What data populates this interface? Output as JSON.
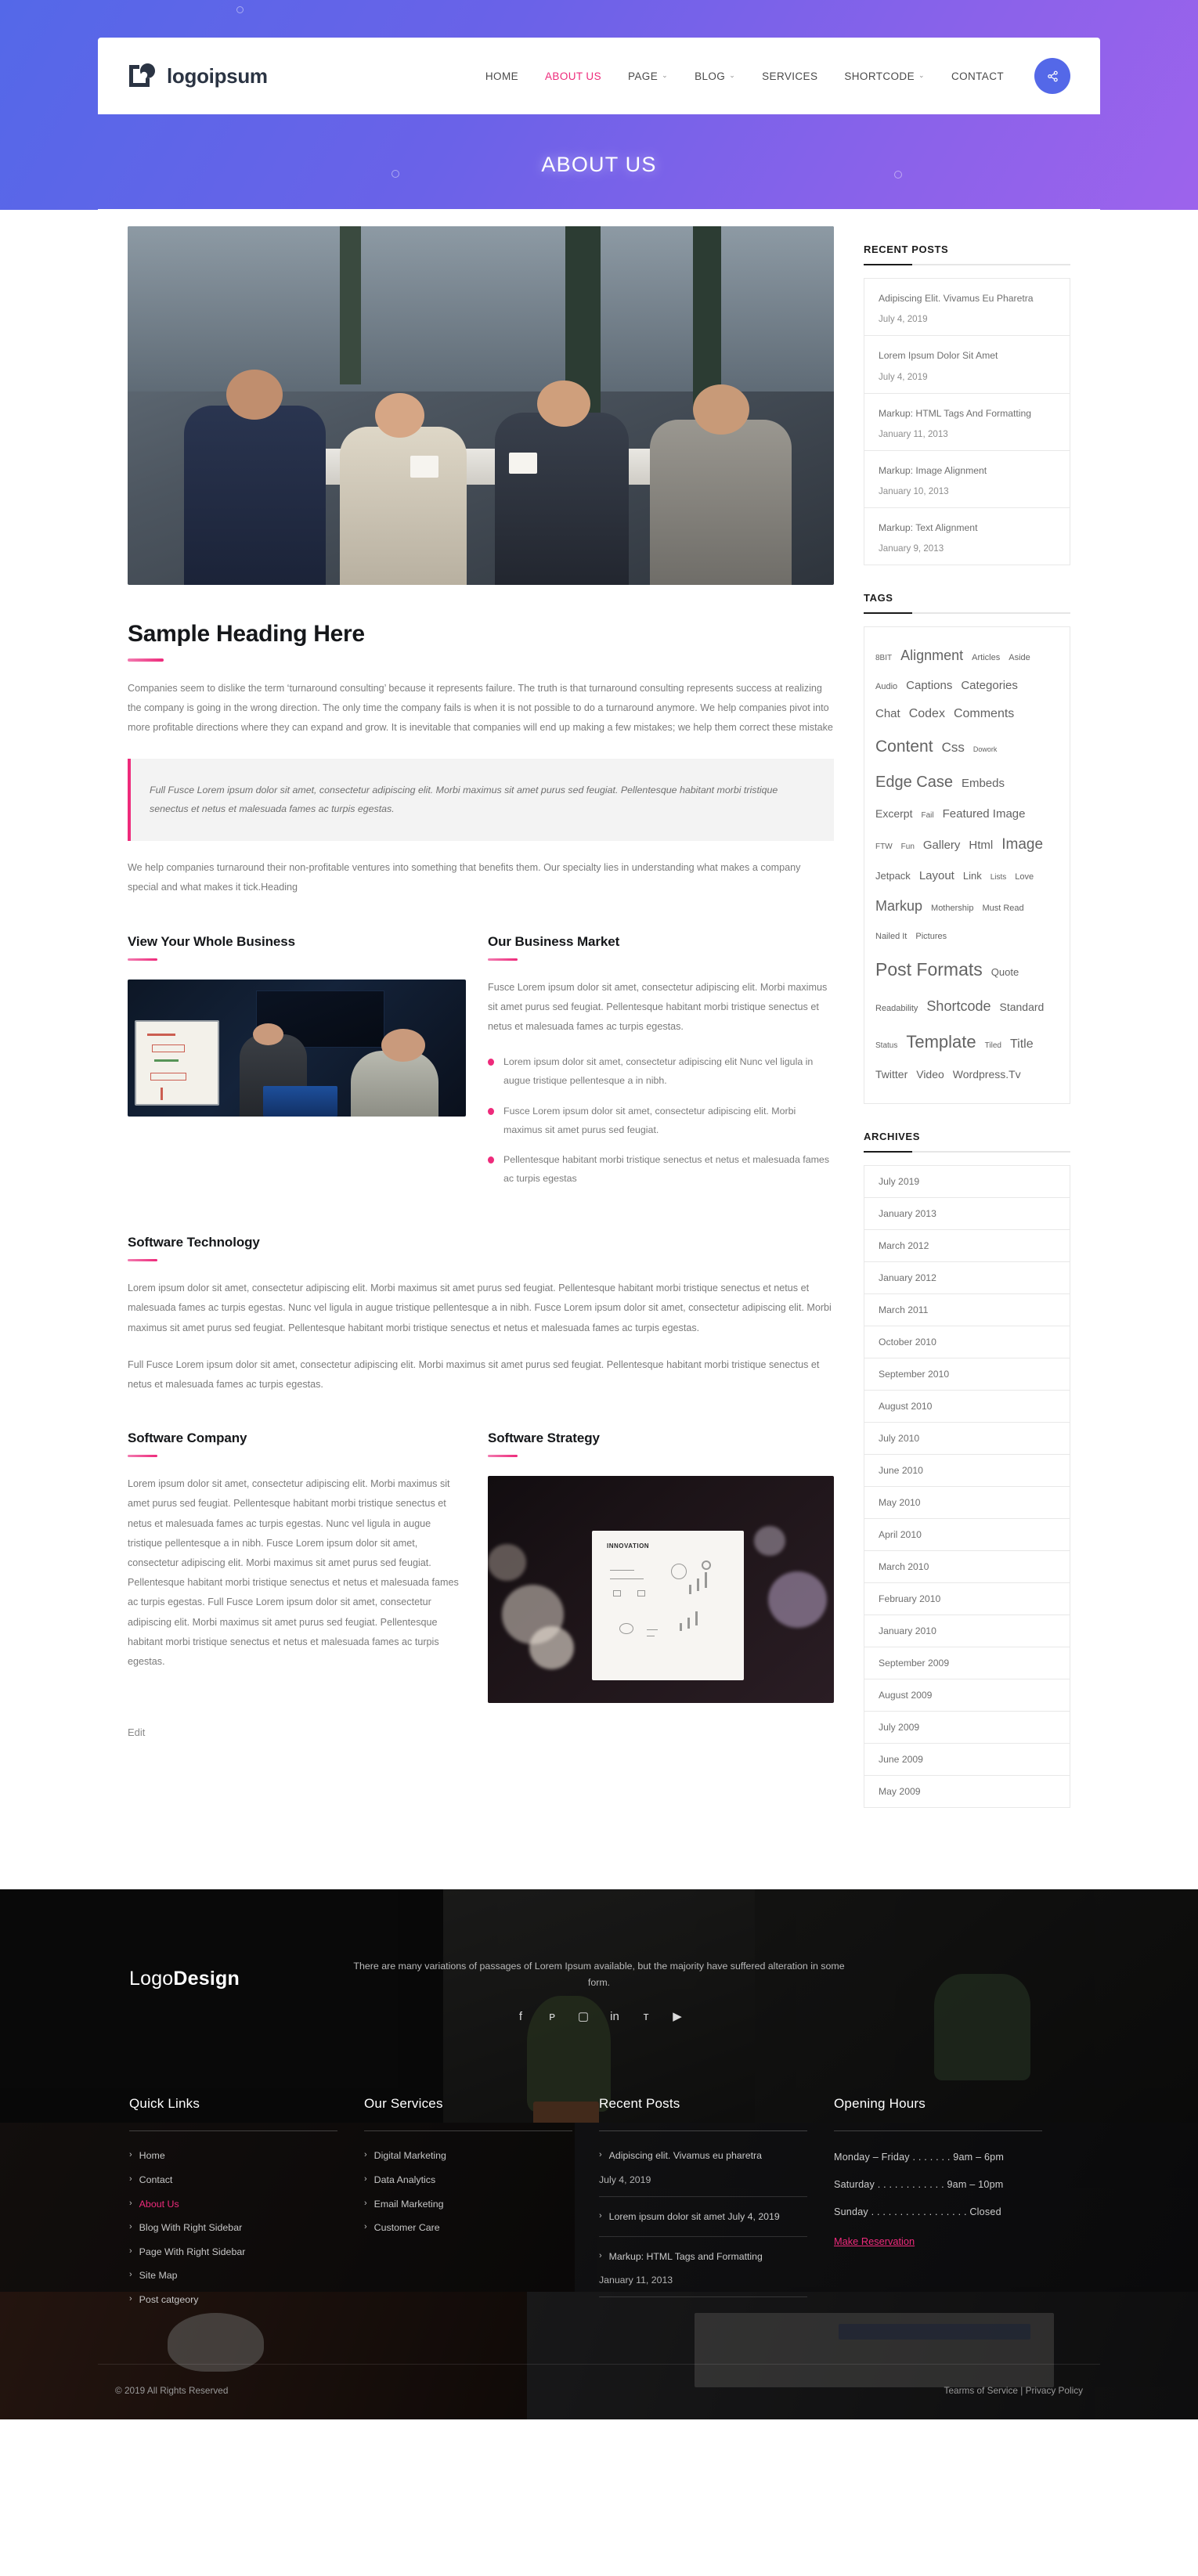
{
  "header": {
    "brand": "logoipsum",
    "brand_icon": "logo-mark-icon",
    "nav": [
      {
        "label": "HOME",
        "active": false,
        "caret": false
      },
      {
        "label": "ABOUT US",
        "active": true,
        "caret": false
      },
      {
        "label": "PAGE",
        "active": false,
        "caret": true
      },
      {
        "label": "BLOG",
        "active": false,
        "caret": true
      },
      {
        "label": "SERVICES",
        "active": false,
        "caret": false
      },
      {
        "label": "SHORTCODE",
        "active": false,
        "caret": true
      },
      {
        "label": "CONTACT",
        "active": false,
        "caret": false
      }
    ],
    "share_icon": "share-icon",
    "page_title": "ABOUT US"
  },
  "main": {
    "heading": "Sample Heading Here",
    "intro": "Companies seem to dislike the term ‘turnaround consulting’ because it represents failure. The truth is that turnaround consulting represents success at realizing the company is going in the wrong direction. The only time the company fails is when it is not possible to do a turnaround anymore. We help companies pivot into more profitable directions where they can expand and grow. It is inevitable that companies will end up making a few mistakes; we help them correct these mistake",
    "quote": "Full Fusce Lorem ipsum dolor sit amet, consectetur adipiscing elit. Morbi maximus sit amet purus sed feugiat. Pellentesque habitant morbi tristique senectus et netus et malesuada fames ac turpis egestas.",
    "after_quote": "We help companies turnaround their non-profitable ventures into something that benefits them. Our specialty lies in understanding what makes a company special and what makes it tick.Heading",
    "block_business": {
      "left_title": "View Your Whole Business",
      "left_image": "office-presentation-photo",
      "right_title": "Our Business Market",
      "right_paragraph": "Fusce Lorem ipsum dolor sit amet, consectetur adipiscing elit. Morbi maximus sit amet purus sed feugiat. Pellentesque habitant morbi tristique senectus et netus et malesuada fames ac turpis egestas.",
      "bullets": [
        "Lorem ipsum dolor sit amet, consectetur adipiscing elit Nunc vel ligula in augue tristique pellentesque a in nibh.",
        "Fusce Lorem ipsum dolor sit amet, consectetur adipiscing elit. Morbi maximus sit amet purus sed feugiat.",
        "Pellentesque habitant morbi tristique senectus et netus et malesuada fames ac turpis egestas"
      ]
    },
    "block_tech": {
      "title": "Software Technology",
      "paragraph1": "Lorem ipsum dolor sit amet, consectetur adipiscing elit. Morbi maximus sit amet purus sed feugiat. Pellentesque habitant morbi tristique senectus et netus et malesuada fames ac turpis egestas. Nunc vel ligula in augue tristique pellentesque a in nibh. Fusce Lorem ipsum dolor sit amet, consectetur adipiscing elit. Morbi maximus sit amet purus sed feugiat. Pellentesque habitant morbi tristique senectus et netus et malesuada fames ac turpis egestas.",
      "paragraph2": "Full Fusce Lorem ipsum dolor sit amet, consectetur adipiscing elit. Morbi maximus sit amet purus sed feugiat. Pellentesque habitant morbi tristique senectus et netus et malesuada fames ac turpis egestas."
    },
    "block_company": {
      "left_title": "Software Company",
      "left_paragraph": "Lorem ipsum dolor sit amet, consectetur adipiscing elit. Morbi maximus sit amet purus sed feugiat. Pellentesque habitant morbi tristique senectus et netus et malesuada fames ac turpis egestas. Nunc vel ligula in augue tristique pellentesque a in nibh. Fusce Lorem ipsum dolor sit amet, consectetur adipiscing elit. Morbi maximus sit amet purus sed feugiat. Pellentesque habitant morbi tristique senectus et netus et malesuada fames ac turpis egestas. Full Fusce Lorem ipsum dolor sit amet, consectetur adipiscing elit. Morbi maximus sit amet purus sed feugiat. Pellentesque habitant morbi tristique senectus et netus et malesuada fames ac turpis egestas.",
      "right_title": "Software Strategy",
      "right_image": "innovation-poster-photo",
      "poster_text": "INNOVATION"
    },
    "edit_link": "Edit"
  },
  "sidebar": {
    "recent_posts_title": "RECENT POSTS",
    "recent_posts": [
      {
        "title": "Adipiscing Elit. Vivamus Eu Pharetra",
        "date": "July 4, 2019"
      },
      {
        "title": "Lorem Ipsum Dolor Sit Amet",
        "date": "July 4, 2019"
      },
      {
        "title": "Markup: HTML Tags And Formatting",
        "date": "January 11, 2013"
      },
      {
        "title": "Markup: Image Alignment",
        "date": "January 10, 2013"
      },
      {
        "title": "Markup: Text Alignment",
        "date": "January 9, 2013"
      }
    ],
    "tags_title": "TAGS",
    "tags": [
      {
        "label": "8BIT",
        "size": 10
      },
      {
        "label": "Alignment",
        "size": 18
      },
      {
        "label": "Articles",
        "size": 11
      },
      {
        "label": "Aside",
        "size": 11
      },
      {
        "label": "Audio",
        "size": 11
      },
      {
        "label": "Captions",
        "size": 15
      },
      {
        "label": "Categories",
        "size": 15
      },
      {
        "label": "Chat",
        "size": 15
      },
      {
        "label": "Codex",
        "size": 16
      },
      {
        "label": "Comments",
        "size": 16
      },
      {
        "label": "Content",
        "size": 21
      },
      {
        "label": "Css",
        "size": 17
      },
      {
        "label": "Dowork",
        "size": 9
      },
      {
        "label": "Edge Case",
        "size": 20
      },
      {
        "label": "Embeds",
        "size": 15
      },
      {
        "label": "Excerpt",
        "size": 14
      },
      {
        "label": "Fail",
        "size": 10
      },
      {
        "label": "Featured Image",
        "size": 15
      },
      {
        "label": "FTW",
        "size": 10
      },
      {
        "label": "Fun",
        "size": 10
      },
      {
        "label": "Gallery",
        "size": 15
      },
      {
        "label": "Html",
        "size": 15
      },
      {
        "label": "Image",
        "size": 19
      },
      {
        "label": "Jetpack",
        "size": 13
      },
      {
        "label": "Layout",
        "size": 15
      },
      {
        "label": "Link",
        "size": 13
      },
      {
        "label": "Lists",
        "size": 10
      },
      {
        "label": "Love",
        "size": 11
      },
      {
        "label": "Markup",
        "size": 18
      },
      {
        "label": "Mothership",
        "size": 11
      },
      {
        "label": "Must Read",
        "size": 11
      },
      {
        "label": "Nailed It",
        "size": 11
      },
      {
        "label": "Pictures",
        "size": 11
      },
      {
        "label": "Post Formats",
        "size": 23
      },
      {
        "label": "Quote",
        "size": 13
      },
      {
        "label": "Readability",
        "size": 11
      },
      {
        "label": "Shortcode",
        "size": 18
      },
      {
        "label": "Standard",
        "size": 14
      },
      {
        "label": "Status",
        "size": 10
      },
      {
        "label": "Template",
        "size": 22
      },
      {
        "label": "Tiled",
        "size": 10
      },
      {
        "label": "Title",
        "size": 16
      },
      {
        "label": "Twitter",
        "size": 14
      },
      {
        "label": "Video",
        "size": 14
      },
      {
        "label": "Wordpress.Tv",
        "size": 14
      }
    ],
    "archives_title": "ARCHIVES",
    "archives": [
      "July 2019",
      "January 2013",
      "March 2012",
      "January 2012",
      "March 2011",
      "October 2010",
      "September 2010",
      "August 2010",
      "July 2010",
      "June 2010",
      "May 2010",
      "April 2010",
      "March 2010",
      "February 2010",
      "January 2010",
      "September 2009",
      "August 2009",
      "July 2009",
      "June 2009",
      "May 2009"
    ]
  },
  "footer": {
    "logo_light": "Logo",
    "logo_bold": "Design",
    "intro": "There are many variations of passages of Lorem Ipsum available, but the majority have suffered alteration in some form.",
    "socials": [
      {
        "name": "facebook-icon",
        "glyph": "f"
      },
      {
        "name": "pinterest-icon",
        "glyph": "ᴘ"
      },
      {
        "name": "instagram-icon",
        "glyph": "▢"
      },
      {
        "name": "linkedin-icon",
        "glyph": "in"
      },
      {
        "name": "twitter-icon",
        "glyph": "ᴛ"
      },
      {
        "name": "youtube-icon",
        "glyph": "▶"
      }
    ],
    "quick_links_title": "Quick Links",
    "quick_links": [
      {
        "label": "Home",
        "active": false
      },
      {
        "label": "Contact",
        "active": false
      },
      {
        "label": "About Us",
        "active": true
      },
      {
        "label": "Blog With Right Sidebar",
        "active": false
      },
      {
        "label": "Page With Right Sidebar",
        "active": false
      },
      {
        "label": "Site Map",
        "active": false
      },
      {
        "label": "Post catgeory",
        "active": false
      }
    ],
    "services_title": "Our Services",
    "services": [
      {
        "label": "Digital Marketing"
      },
      {
        "label": "Data Analytics"
      },
      {
        "label": "Email Marketing"
      },
      {
        "label": "Customer Care"
      }
    ],
    "recent_posts_title": "Recent Posts",
    "recent_posts": [
      {
        "title": "Adipiscing elit. Vivamus eu pharetra",
        "date": "July 4, 2019"
      },
      {
        "title": "Lorem ipsum dolor sit amet July 4, 2019",
        "date": ""
      },
      {
        "title": "Markup: HTML Tags and Formatting",
        "date": "January 11, 2013"
      }
    ],
    "hours_title": "Opening Hours",
    "hours": [
      "Monday – Friday . . . . . . . 9am – 6pm",
      "Saturday . . . . . . . . . . . . 9am – 10pm",
      "Sunday . . . . . . . . . . . . . . . . . Closed"
    ],
    "reserve_label": "Make Reservation",
    "copyright": "© 2019 All Rights Reserved",
    "legal_terms": "Tearms of Service",
    "legal_sep": " | ",
    "legal_privacy": "Privacy Policy"
  },
  "colors": {
    "accent_pink": "#ee2a7b",
    "brand_blue": "#5468e8",
    "hero_purple": "#8a62ea"
  }
}
